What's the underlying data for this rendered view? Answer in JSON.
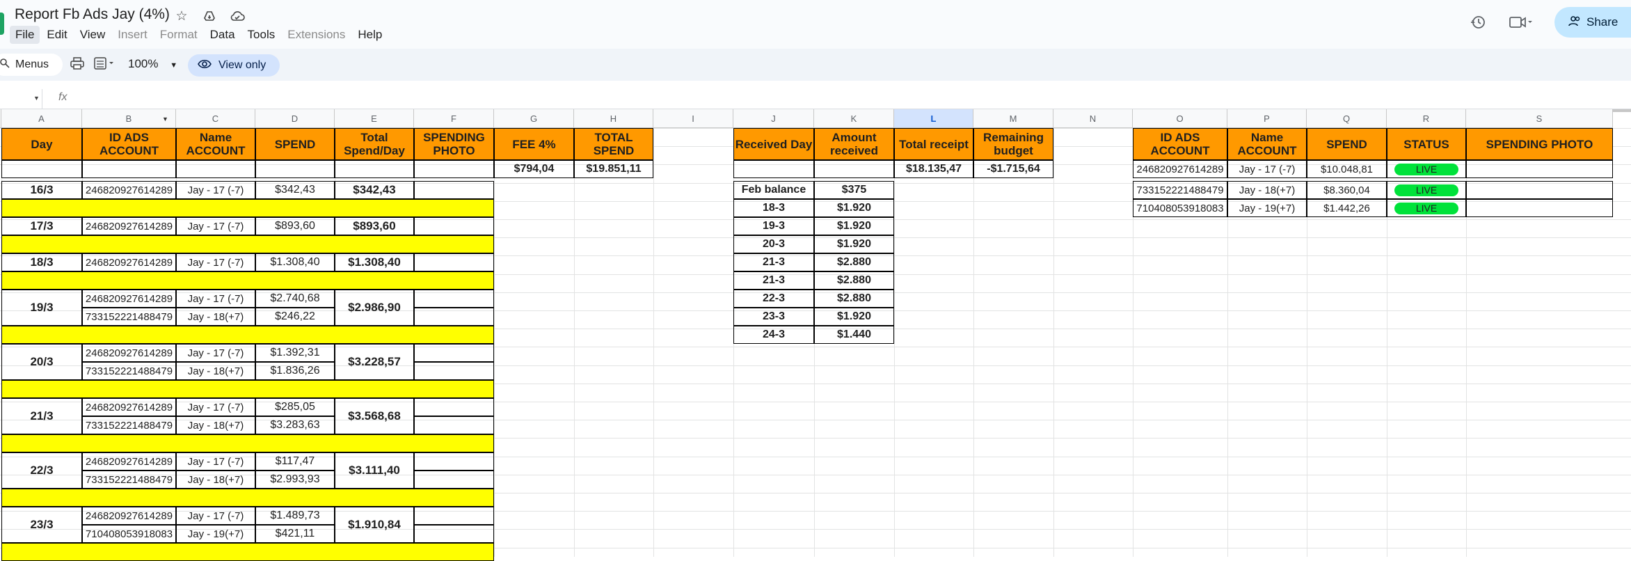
{
  "doc": {
    "title": "Report Fb Ads Jay (4%)",
    "menu": [
      {
        "label": "File",
        "state": "active"
      },
      {
        "label": "Edit",
        "state": "normal"
      },
      {
        "label": "View",
        "state": "normal"
      },
      {
        "label": "Insert",
        "state": "disabled"
      },
      {
        "label": "Format",
        "state": "disabled"
      },
      {
        "label": "Data",
        "state": "normal"
      },
      {
        "label": "Tools",
        "state": "normal"
      },
      {
        "label": "Extensions",
        "state": "disabled"
      },
      {
        "label": "Help",
        "state": "normal"
      }
    ],
    "share_label": "Share"
  },
  "toolbar": {
    "menus_label": "Menus",
    "zoom": "100%",
    "view_only_label": "View only"
  },
  "formula": {
    "fx_label": "fx",
    "content": ""
  },
  "colors": {
    "header": "#ff9900",
    "separator_row": "#ffff00",
    "live": "#00e23a",
    "selected_column": "#d3e3fd"
  },
  "columns": [
    "A",
    "B",
    "C",
    "D",
    "E",
    "F",
    "G",
    "H",
    "I",
    "J",
    "K",
    "L",
    "M",
    "N",
    "O",
    "P",
    "Q",
    "R",
    "S"
  ],
  "selected_column": "L",
  "headers": {
    "A": "Day",
    "B": "ID ADS ACCOUNT",
    "C": "Name ACCOUNT",
    "D": "SPEND",
    "E": "Total Spend/Day",
    "F": "SPENDING PHOTO",
    "G": "FEE 4%",
    "H": "TOTAL SPEND",
    "J": "Received Day",
    "K": "Amount received",
    "L": "Total receipt",
    "M": "Remaining budget",
    "O": "ID ADS ACCOUNT",
    "P": "Name ACCOUNT",
    "Q": "SPEND",
    "R": "STATUS",
    "S": "SPENDING PHOTO"
  },
  "totals": {
    "G": "$794,04",
    "H": "$19.851,11",
    "L": "$18.135,47",
    "M": "-$1.715,64"
  },
  "days": [
    {
      "day": "16/3",
      "total": "$342,43",
      "rows": [
        {
          "id": "246820927614289",
          "name": "Jay - 17 (-7)",
          "spend": "$342,43"
        }
      ]
    },
    {
      "day": "17/3",
      "total": "$893,60",
      "rows": [
        {
          "id": "246820927614289",
          "name": "Jay - 17 (-7)",
          "spend": "$893,60"
        }
      ]
    },
    {
      "day": "18/3",
      "total": "$1.308,40",
      "rows": [
        {
          "id": "246820927614289",
          "name": "Jay - 17 (-7)",
          "spend": "$1.308,40"
        }
      ]
    },
    {
      "day": "19/3",
      "total": "$2.986,90",
      "rows": [
        {
          "id": "246820927614289",
          "name": "Jay - 17 (-7)",
          "spend": "$2.740,68"
        },
        {
          "id": "733152221488479",
          "name": "Jay - 18(+7)",
          "spend": "$246,22"
        }
      ]
    },
    {
      "day": "20/3",
      "total": "$3.228,57",
      "rows": [
        {
          "id": "246820927614289",
          "name": "Jay - 17 (-7)",
          "spend": "$1.392,31"
        },
        {
          "id": "733152221488479",
          "name": "Jay - 18(+7)",
          "spend": "$1.836,26"
        }
      ]
    },
    {
      "day": "21/3",
      "total": "$3.568,68",
      "rows": [
        {
          "id": "246820927614289",
          "name": "Jay - 17 (-7)",
          "spend": "$285,05"
        },
        {
          "id": "733152221488479",
          "name": "Jay - 18(+7)",
          "spend": "$3.283,63"
        }
      ]
    },
    {
      "day": "22/3",
      "total": "$3.111,40",
      "rows": [
        {
          "id": "246820927614289",
          "name": "Jay - 17 (-7)",
          "spend": "$117,47"
        },
        {
          "id": "733152221488479",
          "name": "Jay - 18(+7)",
          "spend": "$2.993,93"
        }
      ]
    },
    {
      "day": "23/3",
      "total": "$1.910,84",
      "rows": [
        {
          "id": "246820927614289",
          "name": "Jay - 17 (-7)",
          "spend": "$1.489,73"
        },
        {
          "id": "710408053918083",
          "name": "Jay - 19(+7)",
          "spend": "$421,11"
        }
      ]
    }
  ],
  "received": [
    {
      "day": "Feb balance",
      "amount": "$375"
    },
    {
      "day": "18-3",
      "amount": "$1.920"
    },
    {
      "day": "19-3",
      "amount": "$1.920"
    },
    {
      "day": "20-3",
      "amount": "$1.920"
    },
    {
      "day": "21-3",
      "amount": "$2.880"
    },
    {
      "day": "21-3",
      "amount": "$2.880"
    },
    {
      "day": "22-3",
      "amount": "$2.880"
    },
    {
      "day": "23-3",
      "amount": "$1.920"
    },
    {
      "day": "24-3",
      "amount": "$1.440"
    }
  ],
  "accounts": [
    {
      "id": "246820927614289",
      "name": "Jay - 17 (-7)",
      "spend": "$10.048,81",
      "status": "LIVE"
    },
    {
      "id": "733152221488479",
      "name": "Jay - 18(+7)",
      "spend": "$8.360,04",
      "status": "LIVE"
    },
    {
      "id": "710408053918083",
      "name": "Jay - 19(+7)",
      "spend": "$1.442,26",
      "status": "LIVE"
    }
  ]
}
